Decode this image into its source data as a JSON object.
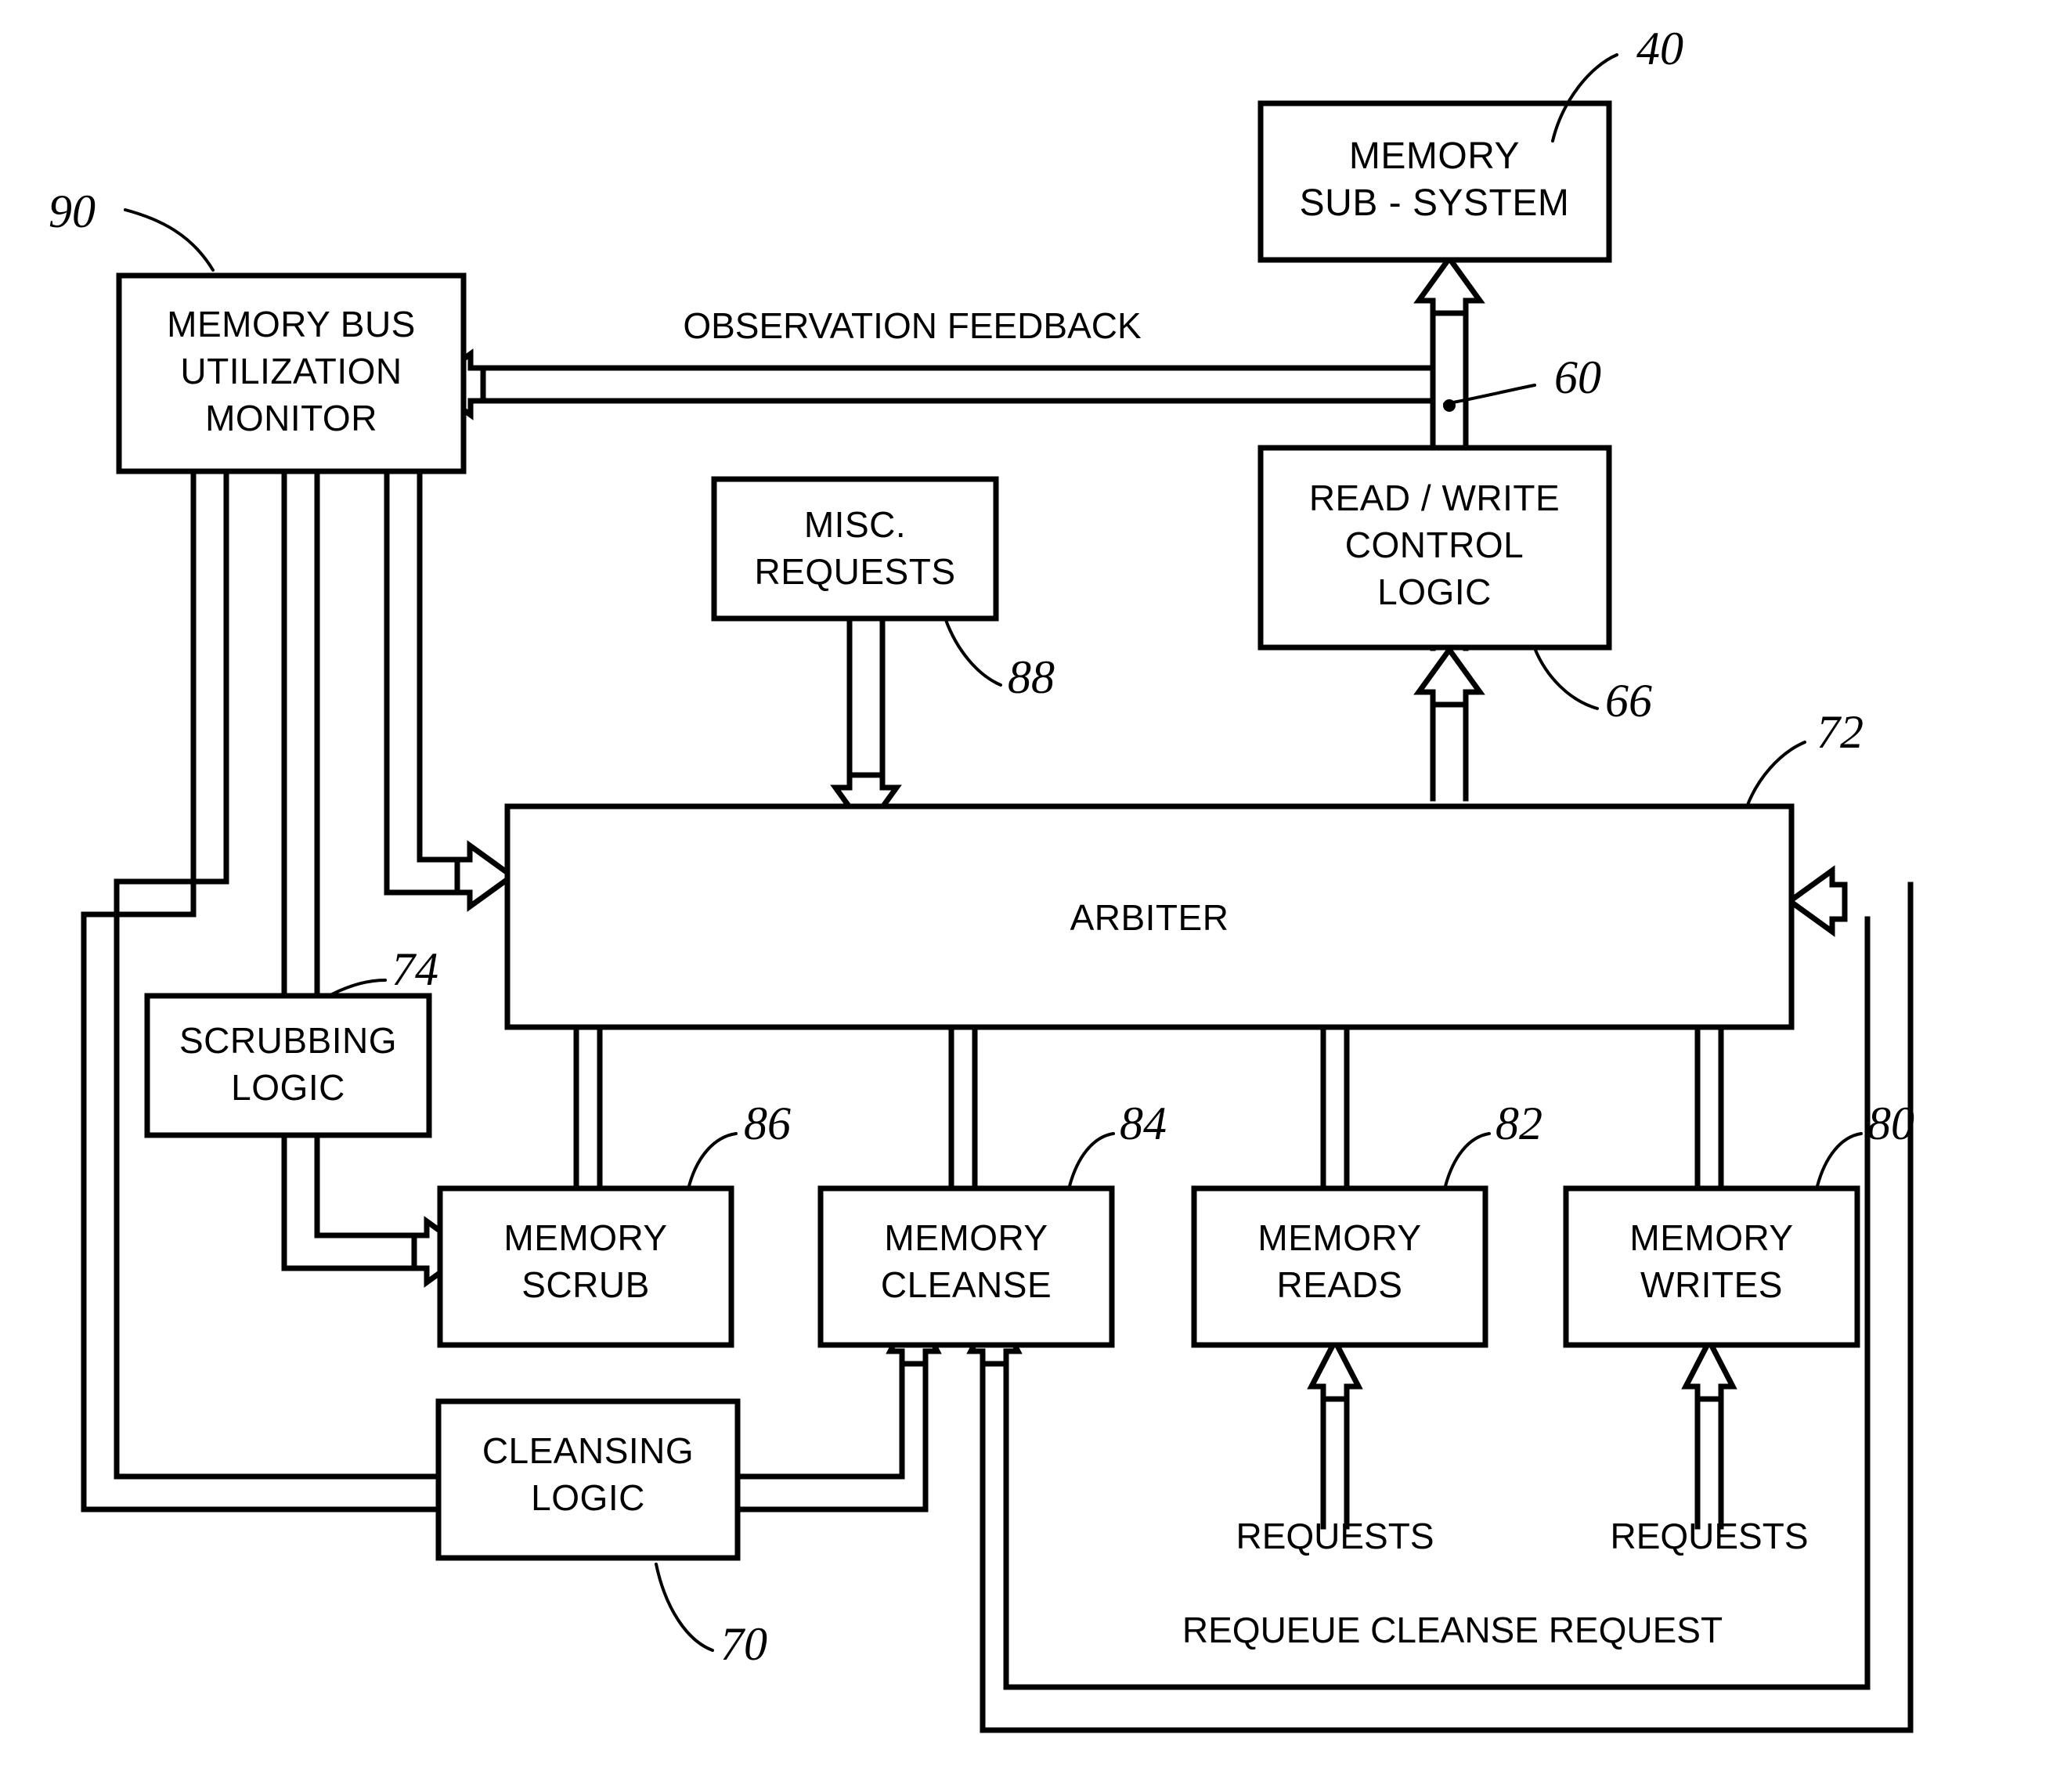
{
  "figure": {
    "type": "patent-block-diagram",
    "title": "Memory subsystem arbitration block diagram"
  },
  "blocks": [
    {
      "id": "memory-sub-system",
      "lines": [
        "MEMORY",
        "SUB - SYSTEM"
      ],
      "ref": "40"
    },
    {
      "id": "memory-bus-utilization-monitor",
      "lines": [
        "MEMORY BUS",
        "UTILIZATION",
        "MONITOR"
      ],
      "ref": "90"
    },
    {
      "id": "read-write-control-logic",
      "lines": [
        "READ / WRITE",
        "CONTROL",
        "LOGIC"
      ],
      "ref": "66"
    },
    {
      "id": "misc-requests",
      "lines": [
        "MISC.",
        "REQUESTS"
      ],
      "ref": "88"
    },
    {
      "id": "arbiter",
      "lines": [
        "ARBITER"
      ],
      "ref": "72"
    },
    {
      "id": "scrubbing-logic",
      "lines": [
        "SCRUBBING",
        "LOGIC"
      ],
      "ref": "74"
    },
    {
      "id": "memory-scrub",
      "lines": [
        "MEMORY",
        "SCRUB"
      ],
      "ref": "86"
    },
    {
      "id": "memory-cleanse",
      "lines": [
        "MEMORY",
        "CLEANSE"
      ],
      "ref": "84"
    },
    {
      "id": "memory-reads",
      "lines": [
        "MEMORY",
        "READS"
      ],
      "ref": "82"
    },
    {
      "id": "memory-writes",
      "lines": [
        "MEMORY",
        "WRITES"
      ],
      "ref": "80"
    },
    {
      "id": "cleansing-logic",
      "lines": [
        "CLEANSING",
        "LOGIC"
      ],
      "ref": "70"
    }
  ],
  "labels": {
    "memory_sub_system_l1": "MEMORY",
    "memory_sub_system_l2": "SUB - SYSTEM",
    "monitor_l1": "MEMORY BUS",
    "monitor_l2": "UTILIZATION",
    "monitor_l3": "MONITOR",
    "rw_control_l1": "READ / WRITE",
    "rw_control_l2": "CONTROL",
    "rw_control_l3": "LOGIC",
    "misc_l1": "MISC.",
    "misc_l2": "REQUESTS",
    "arbiter": "ARBITER",
    "scrubbing_l1": "SCRUBBING",
    "scrubbing_l2": "LOGIC",
    "memory_scrub_l1": "MEMORY",
    "memory_scrub_l2": "SCRUB",
    "memory_cleanse_l1": "MEMORY",
    "memory_cleanse_l2": "CLEANSE",
    "memory_reads_l1": "MEMORY",
    "memory_reads_l2": "READS",
    "memory_writes_l1": "MEMORY",
    "memory_writes_l2": "WRITES",
    "cleansing_l1": "CLEANSING",
    "cleansing_l2": "LOGIC"
  },
  "connection_labels": {
    "observation_feedback": "OBSERVATION FEEDBACK",
    "requests_reads": "REQUESTS",
    "requests_writes": "REQUESTS",
    "requeue_cleanse_request": "REQUEUE CLEANSE REQUEST"
  },
  "reference_numerals": {
    "memory_sub_system": "40",
    "read_write_control_logic": "60",
    "control_logic_input": "66",
    "cleansing_logic": "70",
    "arbiter": "72",
    "scrubbing_logic": "74",
    "memory_writes": "80",
    "memory_reads": "82",
    "memory_cleanse": "84",
    "memory_scrub": "86",
    "misc_requests": "88",
    "memory_bus_utilization_monitor": "90"
  },
  "colors": {
    "ink": "#000000",
    "paper": "#ffffff"
  }
}
